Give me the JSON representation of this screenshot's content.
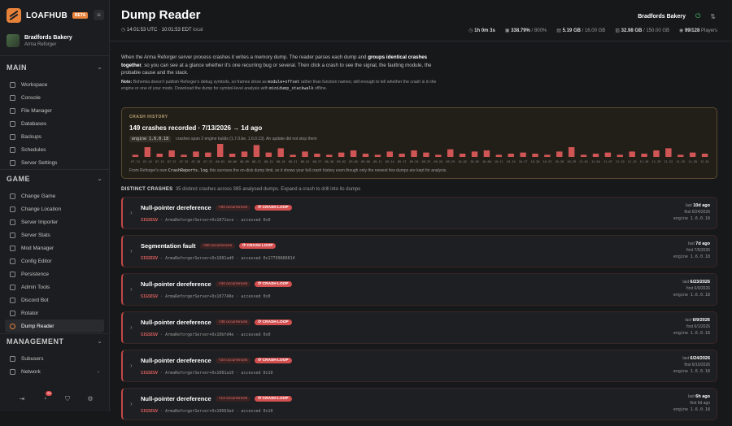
{
  "brand": {
    "name": "LOAFHUB",
    "badge": "BETA"
  },
  "server": {
    "name": "Bradfords Bakery",
    "game": "Arma Reforger"
  },
  "nav": {
    "main_title": "MAIN",
    "main": [
      {
        "label": "Workspace"
      },
      {
        "label": "Console"
      },
      {
        "label": "File Manager"
      },
      {
        "label": "Databases"
      },
      {
        "label": "Backups"
      },
      {
        "label": "Schedules"
      },
      {
        "label": "Server Settings"
      }
    ],
    "game_title": "GAME",
    "game": [
      {
        "label": "Change Game"
      },
      {
        "label": "Change Location"
      },
      {
        "label": "Server Importer"
      },
      {
        "label": "Server Stats"
      },
      {
        "label": "Mod Manager"
      },
      {
        "label": "Config Editor"
      },
      {
        "label": "Persistence"
      },
      {
        "label": "Admin Tools"
      },
      {
        "label": "Discord Bot"
      },
      {
        "label": "Rotator"
      },
      {
        "label": "Dump Reader"
      }
    ],
    "management_title": "MANAGEMENT",
    "management": [
      {
        "label": "Subusers"
      },
      {
        "label": "Network"
      }
    ],
    "notif_count": "99"
  },
  "header": {
    "title": "Dump Reader",
    "time_utc": "14:01:53 UTC",
    "time_local": "10:01:53 EDT",
    "local_label": "local",
    "server_name": "Bradfords Bakery",
    "stats": [
      {
        "value": "1h 0m 3s",
        "suffix": ""
      },
      {
        "value": "338.79%",
        "suffix": " / 800%"
      },
      {
        "value": "5.19 GB",
        "suffix": " / 16.00 GB"
      },
      {
        "value": "32.98 GB",
        "suffix": " / 150.00 GB"
      },
      {
        "value": "99/128",
        "suffix": " Players"
      }
    ]
  },
  "intro": {
    "p1a": "When the Arma Reforger server process crashes it writes a memory dump. The reader parses each dump and ",
    "p1b": "groups identical crashes together",
    "p1c": ", so you can see at a glance whether it's one recurring bug or several. Then click a crash to see the signal, the faulting module, the probable cause and the stack.",
    "note_label": "Note:",
    "note_a": " Bohemia doesn't publish Reforger's debug symbols, so frames show as ",
    "note_code1": "module+offset",
    "note_b": " rather than function names; still enough to tell whether the crash is in the engine or one of your mods. Download the dump for symbol-level analysis with ",
    "note_code2": "minidump_stackwalk",
    "note_c": " offline."
  },
  "history": {
    "label": "CRASH HISTORY",
    "title": "149 crashes recorded · 7/13/2026 → 1d ago",
    "engine": "engine 1.6.0.18",
    "engine_note": "crashes span 2 engine builds (1.7.0.be, 1.6.0.13). An update did not stop them",
    "footer_a": "From Reforger's own ",
    "footer_code": "CrashReports.log",
    "footer_b": ", this survives the on-disk dump limit, so it shows your full crash history even though only the newest few dumps are kept for analysis.",
    "bar_color": "#d05555",
    "bar_values": [
      2,
      9,
      3,
      6,
      2,
      5,
      4,
      12,
      3,
      5,
      11,
      4,
      8,
      2,
      5,
      3,
      2,
      4,
      6,
      3,
      2,
      5,
      3,
      6,
      4,
      2,
      7,
      3,
      5,
      6,
      2,
      3,
      4,
      3,
      2,
      5,
      9,
      2,
      3,
      4,
      2,
      5,
      3,
      6,
      8,
      2,
      4,
      3
    ],
    "date_labels": [
      "07-13",
      "07-16",
      "07-19",
      "07-22",
      "07-25",
      "07-28",
      "07-31",
      "08-03",
      "08-06",
      "08-09",
      "08-12",
      "08-15",
      "08-18",
      "08-21",
      "08-24",
      "08-27",
      "08-30",
      "09-02",
      "09-05",
      "09-08",
      "09-11",
      "09-14",
      "09-17",
      "09-20",
      "09-23",
      "09-26",
      "09-29",
      "10-02",
      "10-05",
      "10-08",
      "10-11",
      "10-14",
      "10-17",
      "10-20",
      "10-23",
      "10-26",
      "10-29",
      "11-01",
      "11-04",
      "11-07",
      "11-10",
      "11-13",
      "11-16",
      "11-19",
      "11-22",
      "11-25",
      "11-28",
      "12-01"
    ]
  },
  "distinct": {
    "label": "DISTINCT CRASHES",
    "text": "35 distinct crashes across 385 analysed dumps. Expand a crash to drill into its dumps"
  },
  "crashes": [
    {
      "name": "Null-pointer dereference",
      "occ": "×93 occurrences",
      "loop": "⟳ CRASH LOOP",
      "sig": "SIGSEGV",
      "addr": " · ArmaReforgerServer+0x1071ece · accessed 0x0",
      "last_label": "last",
      "last": "10d ago",
      "first": "first 6/24/2026",
      "engine": "engine 1.6.0.18"
    },
    {
      "name": "Segmentation fault",
      "occ": "×50 occurrences",
      "loop": "⟳ CRASH LOOP",
      "sig": "SIGSEGV",
      "addr": " · ArmaReforgerServer+0x1081ad0 · accessed 0x17709888814",
      "last_label": "last",
      "last": "7d ago",
      "first": "first 7/5/2026",
      "engine": "engine 1.6.0.18"
    },
    {
      "name": "Null-pointer dereference",
      "occ": "×34 occurrences",
      "loop": "⟳ CRASH LOOP",
      "sig": "SIGSEGV",
      "addr": " · ArmaReforgerServer+0x1077A0e · accessed 0x0",
      "last_label": "last",
      "last": "6/23/2026",
      "first": "first 6/9/2026",
      "engine": "engine 1.6.0.18"
    },
    {
      "name": "Null-pointer dereference",
      "occ": "×35 occurrences",
      "loop": "⟳ CRASH LOOP",
      "sig": "SIGSEGV",
      "addr": " · ArmaReforgerServer+0x10bfd4e · accessed 0x0",
      "last_label": "last",
      "last": "6/9/2026",
      "first": "first 6/1/2026",
      "engine": "engine 1.6.0.18"
    },
    {
      "name": "Null-pointer dereference",
      "occ": "×24 occurrences",
      "loop": "⟳ CRASH LOOP",
      "sig": "SIGSEGV",
      "addr": " · ArmaReforgerServer+0x1081a10 · accessed 0x10",
      "last_label": "last",
      "last": "6/24/2026",
      "first": "first 6/10/2026",
      "engine": "engine 1.6.0.18"
    },
    {
      "name": "Null-pointer dereference",
      "occ": "×13 occurrences",
      "loop": "⟳ CRASH LOOP",
      "sig": "SIGSEGV",
      "addr": " · ArmaReforgerServer+0x10663ed · accessed 0x10",
      "last_label": "last",
      "last": "6h ago",
      "first": "first 6d ago",
      "engine": "engine 1.6.0.18"
    }
  ]
}
